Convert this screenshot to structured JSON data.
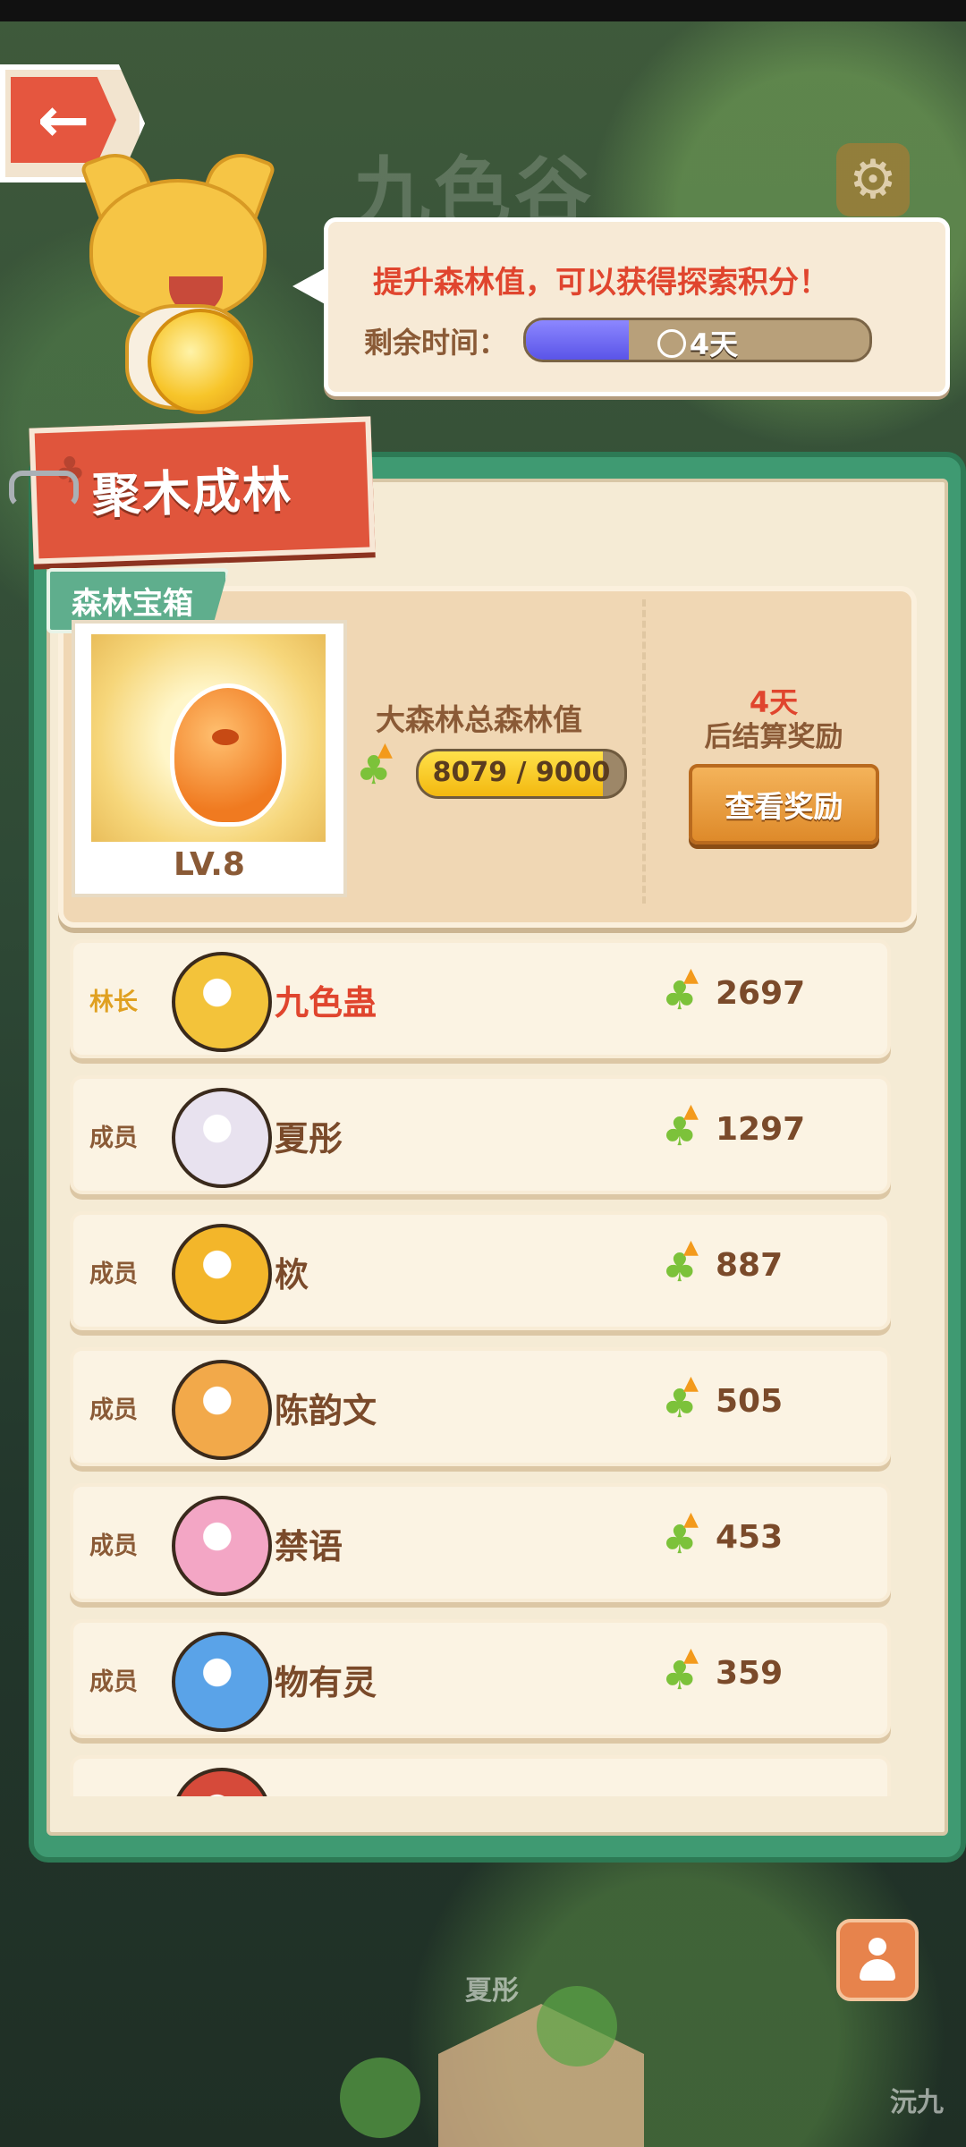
{
  "page": {
    "bg_title": "九色谷"
  },
  "back_label": "←",
  "bubble": {
    "text": "提升森林值，可以获得探索积分！",
    "time_label": "剩余时间：",
    "time_remaining": "4天",
    "time_progress": 0.3
  },
  "banner": {
    "title": "聚木成林"
  },
  "chest": {
    "tag": "森林宝箱",
    "level": "LV.8",
    "forest_title": "大森林总森林值",
    "forest_value": "8079 / 9000",
    "forest_current": 8079,
    "forest_max": 9000,
    "days": "4天",
    "settle_text": "后结算奖励",
    "reward_button": "查看奖励"
  },
  "members": [
    {
      "role": "林长",
      "name": "九色蛊",
      "score": "2697",
      "leader": true,
      "avatar_color": "#f3c33a"
    },
    {
      "role": "成员",
      "name": "夏彤",
      "score": "1297",
      "leader": false,
      "avatar_color": "#e8e2ef"
    },
    {
      "role": "成员",
      "name": "栨",
      "score": "887",
      "leader": false,
      "avatar_color": "#f3b62a"
    },
    {
      "role": "成员",
      "name": "陈韵文",
      "score": "505",
      "leader": false,
      "avatar_color": "#f2a94a"
    },
    {
      "role": "成员",
      "name": "禁语",
      "score": "453",
      "leader": false,
      "avatar_color": "#f3a6c5"
    },
    {
      "role": "成员",
      "name": "物有灵",
      "score": "359",
      "leader": false,
      "avatar_color": "#5aa3e8"
    },
    {
      "role": "",
      "name": "",
      "score": "",
      "leader": false,
      "avatar_color": "#d64a3a"
    }
  ],
  "map_labels": [
    "夏彤",
    "沅九"
  ],
  "colors": {
    "accent_red": "#e0452e",
    "panel_green": "#3f9a72",
    "brown_text": "#8a5a36"
  }
}
